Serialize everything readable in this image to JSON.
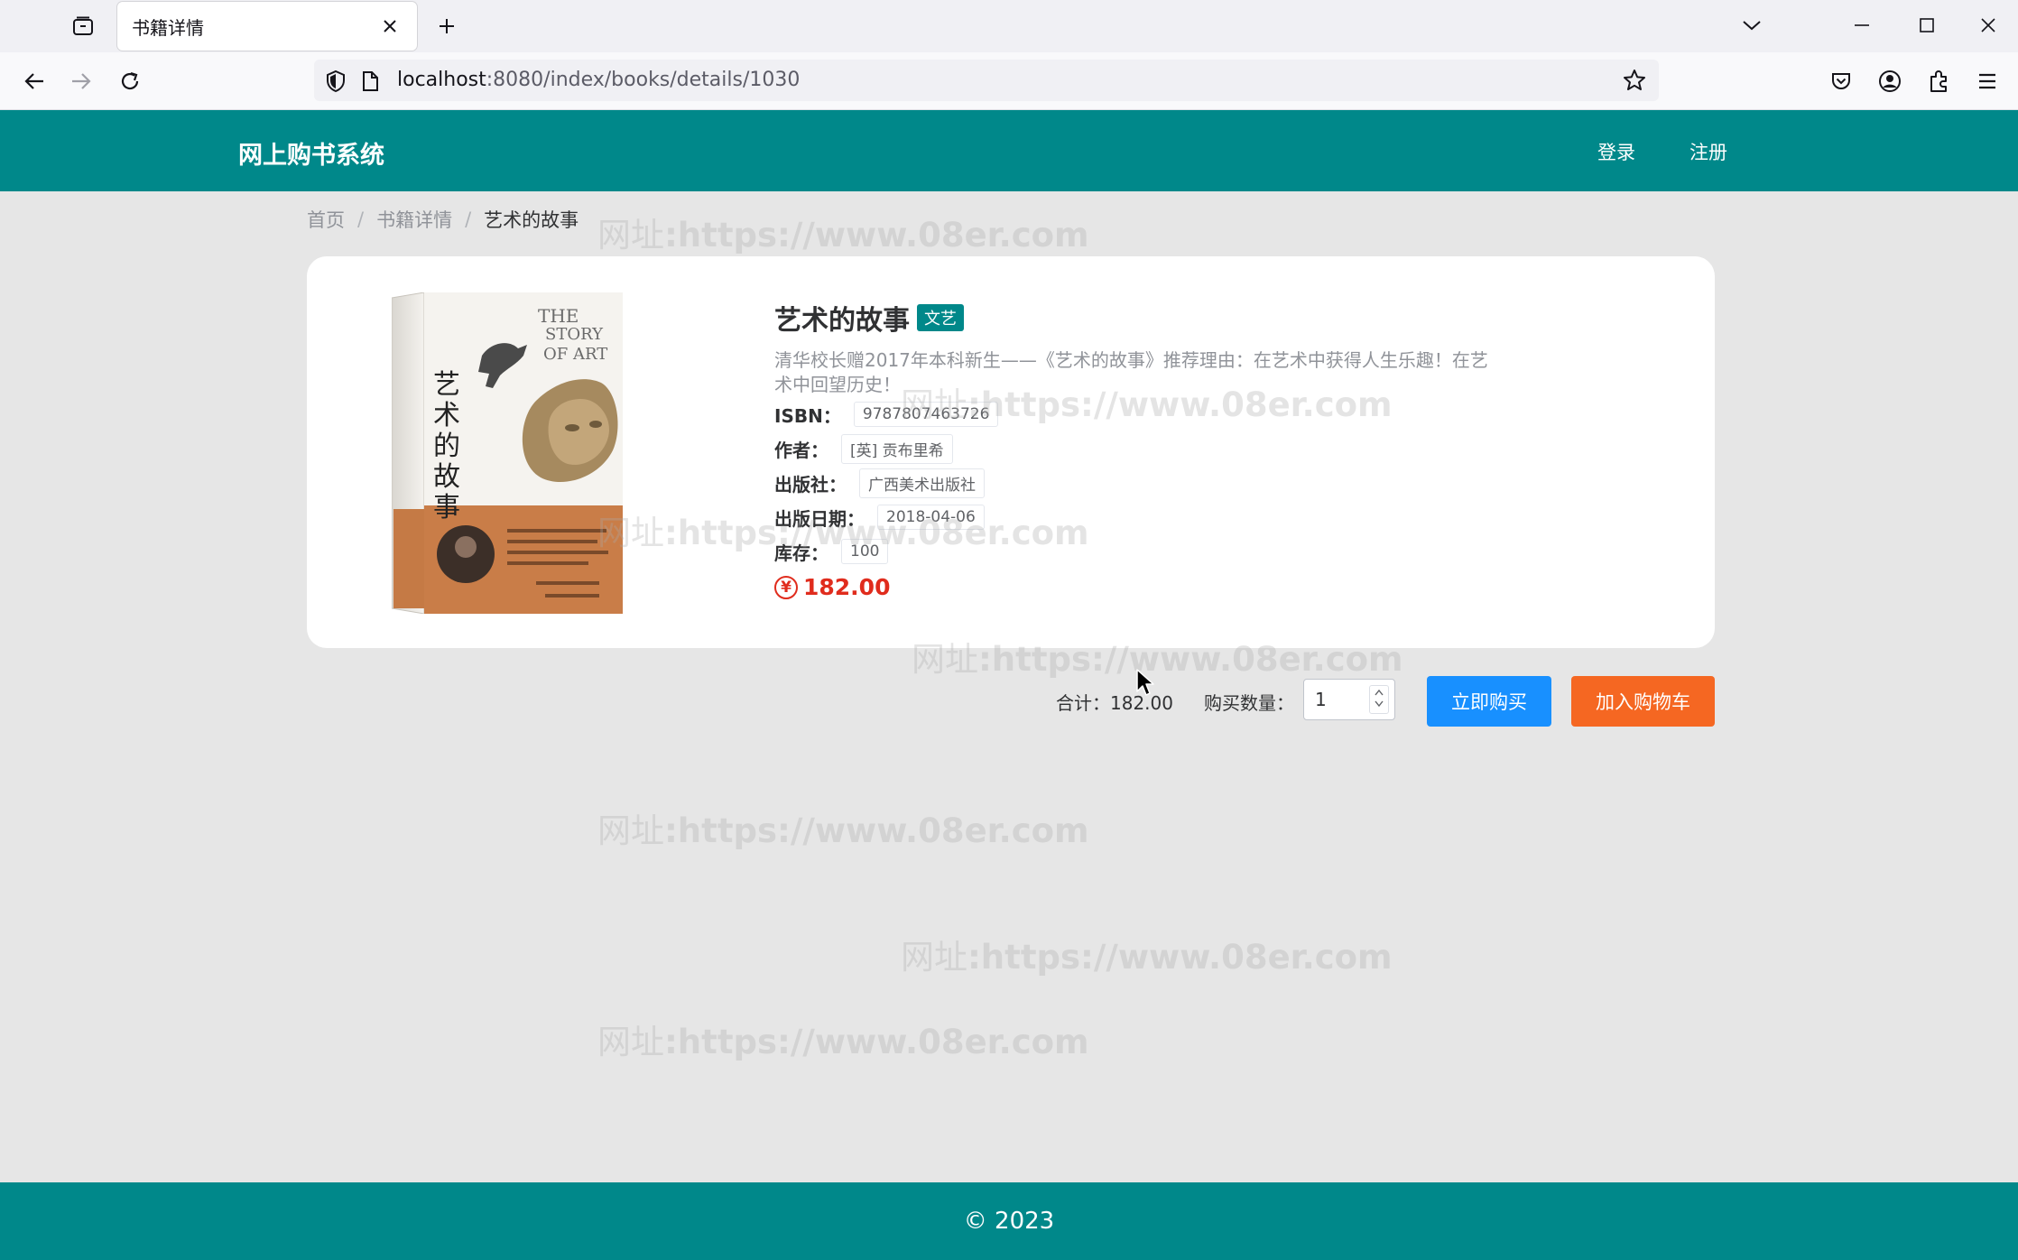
{
  "browser": {
    "tab_title": "书籍详情",
    "url_host": "localhost",
    "url_path": ":8080/index/books/details/1030"
  },
  "site": {
    "logo": "网上购书系统",
    "nav": {
      "login": "登录",
      "register": "注册"
    }
  },
  "breadcrumb": {
    "items": [
      "首页",
      "书籍详情",
      "艺术的故事"
    ],
    "separator": "/"
  },
  "book": {
    "title": "艺术的故事",
    "category": "文艺",
    "description": "清华校长赠2017年本科新生——《艺术的故事》推荐理由：在艺术中获得人生乐趣！在艺术中回望历史！",
    "fields": [
      {
        "label": "ISBN：",
        "value": "9787807463726"
      },
      {
        "label": "作者：",
        "value": "[英] 贡布里希"
      },
      {
        "label": "出版社：",
        "value": "广西美术出版社"
      },
      {
        "label": "出版日期：",
        "value": "2018-04-06"
      },
      {
        "label": "库存：",
        "value": "100"
      }
    ],
    "currency_symbol": "¥",
    "price": "182.00",
    "cover_text": {
      "title_cn": "艺术的故事",
      "title_en_1": "THE",
      "title_en_2": "STORY",
      "title_en_3": "OF ART"
    }
  },
  "purchase": {
    "total_label": "合计：",
    "total_value": "182.00",
    "quantity_label": "购买数量：",
    "quantity": "1",
    "buy_now": "立即购买",
    "add_to_cart": "加入购物车"
  },
  "footer": {
    "text": "© 2023"
  },
  "watermark": {
    "prefix": "网址",
    "url": ":https://www.08er.com"
  },
  "colors": {
    "brand": "#00888a",
    "buy_button": "#1890ff",
    "cart_button": "#f56722",
    "price": "#e02c1d",
    "background": "#e6e6e6"
  },
  "icons": [
    "tab-list-icon",
    "close-icon",
    "plus-icon",
    "chevron-down-icon",
    "minimize-icon",
    "maximize-icon",
    "back-icon",
    "forward-icon",
    "reload-icon",
    "shield-icon",
    "page-icon",
    "star-icon",
    "pocket-icon",
    "account-icon",
    "extensions-icon",
    "menu-icon",
    "yen-icon"
  ]
}
